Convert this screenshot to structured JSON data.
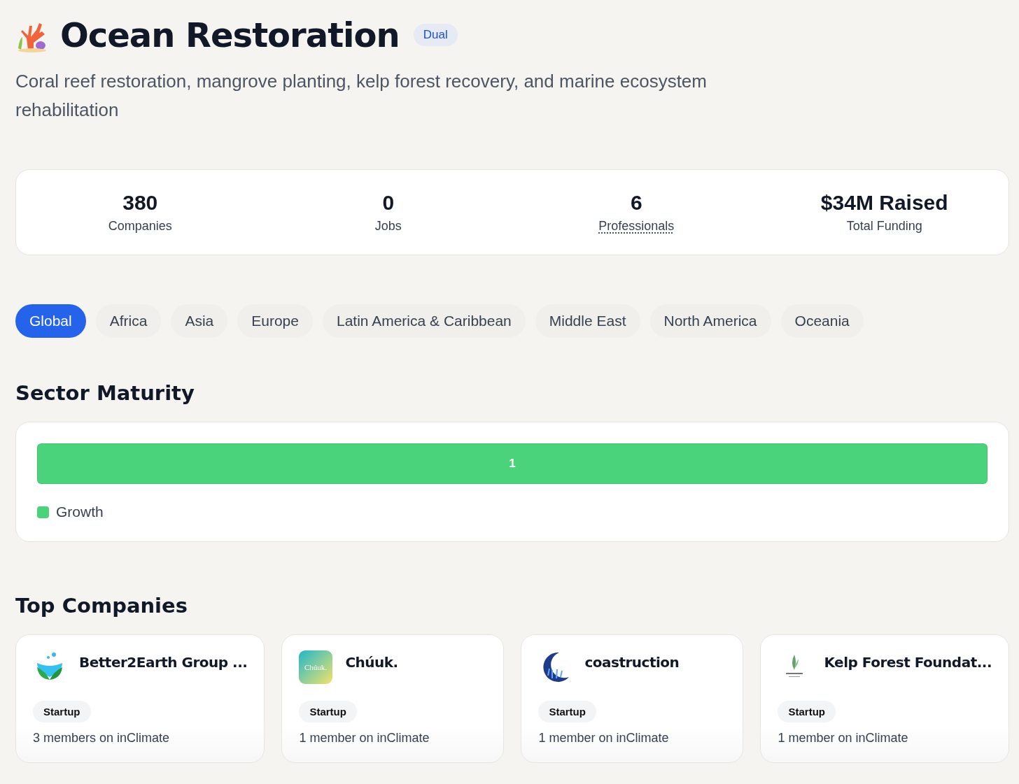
{
  "header": {
    "title": "Ocean Restoration",
    "badge": "Dual",
    "description": "Coral reef restoration, mangrove planting, kelp forest recovery, and marine ecosystem rehabilitation"
  },
  "stats": [
    {
      "value": "380",
      "label": "Companies",
      "kind": "plain"
    },
    {
      "value": "0",
      "label": "Jobs",
      "kind": "plain"
    },
    {
      "value": "6",
      "label": "Professionals",
      "kind": "link"
    },
    {
      "value": "$34M Raised",
      "label": "Total Funding",
      "kind": "plain"
    }
  ],
  "region_tabs": [
    {
      "label": "Global",
      "selected": true
    },
    {
      "label": "Africa",
      "selected": false
    },
    {
      "label": "Asia",
      "selected": false
    },
    {
      "label": "Europe",
      "selected": false
    },
    {
      "label": "Latin America & Caribbean",
      "selected": false
    },
    {
      "label": "Middle East",
      "selected": false
    },
    {
      "label": "North America",
      "selected": false
    },
    {
      "label": "Oceania",
      "selected": false
    }
  ],
  "sector_maturity": {
    "title": "Sector Maturity",
    "segments": [
      {
        "label": "1",
        "level": 1,
        "color": "#4ad37b"
      }
    ],
    "legend": [
      {
        "label": "Growth",
        "color": "#4ad37b"
      }
    ]
  },
  "top_companies": {
    "title": "Top Companies",
    "companies": [
      {
        "name": "Better2Earth Group ...",
        "kind": "leaf",
        "stage": "Startup",
        "members": "3 members on inClimate"
      },
      {
        "name": "Chúuk.",
        "kind": "wordmark",
        "logo_text": "Chúuk.",
        "stage": "Startup",
        "members": "1 member on inClimate"
      },
      {
        "name": "coastruction",
        "kind": "crescent",
        "stage": "Startup",
        "members": "1 member on inClimate"
      },
      {
        "name": "Kelp Forest Foundat...",
        "kind": "kelp",
        "stage": "Startup",
        "members": "1 member on inClimate"
      }
    ]
  }
}
